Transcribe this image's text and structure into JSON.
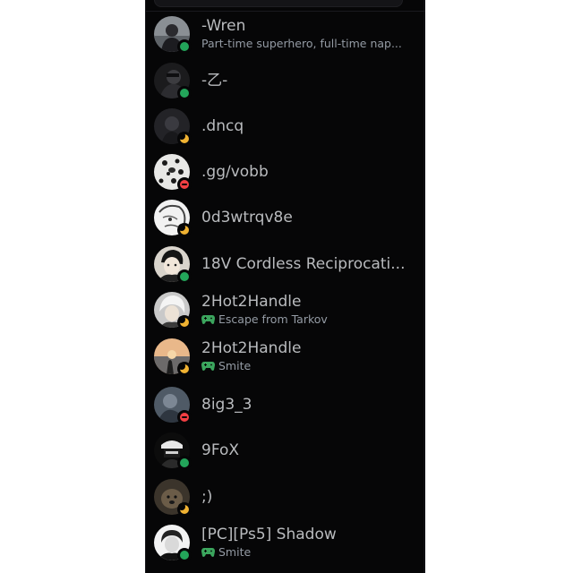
{
  "members": [
    {
      "name": "-Wren",
      "subtext": "Part-time superhero, full-time nap...",
      "activity_icon": "",
      "status": "online",
      "avatar": "person-dark-hoodie"
    },
    {
      "name": "-乙-",
      "subtext": "",
      "activity_icon": "",
      "status": "online",
      "avatar": "dark-anime-figure"
    },
    {
      "name": ".dncq",
      "subtext": "",
      "activity_icon": "",
      "status": "idle",
      "avatar": "dark-figure"
    },
    {
      "name": ".gg/vobb",
      "subtext": "",
      "activity_icon": "",
      "status": "dnd",
      "avatar": "dalmatian-dog"
    },
    {
      "name": "0d3wtrqv8e",
      "subtext": "",
      "activity_icon": "",
      "status": "idle",
      "avatar": "manga-sketch"
    },
    {
      "name": "18V Cordless Reciprocati...",
      "subtext": "",
      "activity_icon": "",
      "status": "online",
      "avatar": "anime-boy"
    },
    {
      "name": "2Hot2Handle",
      "subtext": "Escape from Tarkov",
      "activity_icon": "gamepad-icon",
      "status": "idle",
      "avatar": "anime-white-hair"
    },
    {
      "name": "2Hot2Handle",
      "subtext": "Smite",
      "activity_icon": "gamepad-icon",
      "status": "idle",
      "avatar": "sunset-silhouette"
    },
    {
      "name": "8ig3_3",
      "subtext": "",
      "activity_icon": "",
      "status": "dnd",
      "avatar": "blue-gray-figure"
    },
    {
      "name": "9FoX",
      "subtext": "",
      "activity_icon": "",
      "status": "online",
      "avatar": "masked-figure"
    },
    {
      "name": ";)",
      "subtext": "",
      "activity_icon": "",
      "status": "idle",
      "avatar": "sepia-dog"
    },
    {
      "name": "[PC][Ps5] Shadow",
      "subtext": "Smite",
      "activity_icon": "gamepad-icon",
      "status": "online",
      "avatar": "white-portrait"
    }
  ],
  "colors": {
    "background": "#060607",
    "name_text": "#b9bbbe",
    "sub_text": "#949ba4",
    "online": "#23a55a",
    "idle": "#f0b232",
    "dnd": "#f23f43",
    "gamepad": "#3ba55d"
  }
}
